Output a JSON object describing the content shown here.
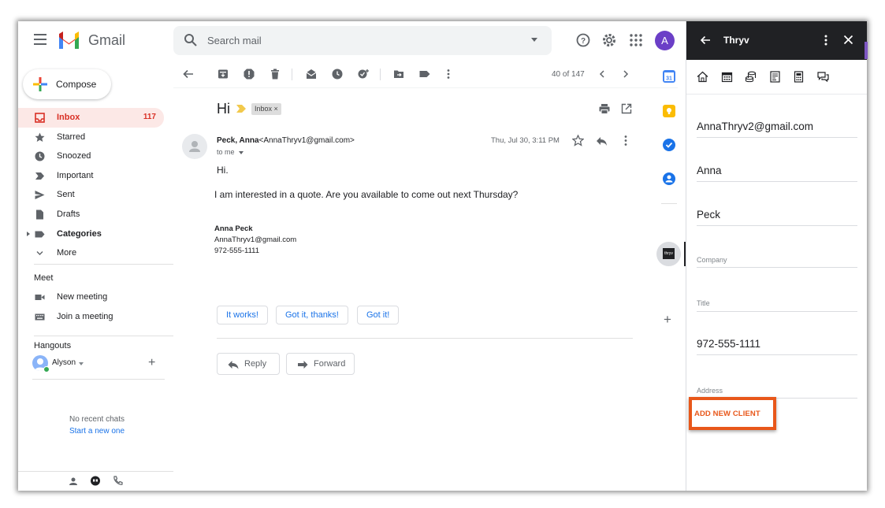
{
  "app": {
    "brand": "Gmail"
  },
  "search": {
    "placeholder": "Search mail"
  },
  "account": {
    "avatar_letter": "A",
    "avatar_color": "#6b3fc7"
  },
  "compose": {
    "label": "Compose"
  },
  "sidebar": {
    "items": [
      {
        "label": "Inbox",
        "count": "117",
        "icon": "inbox-icon"
      },
      {
        "label": "Starred",
        "icon": "star-icon"
      },
      {
        "label": "Snoozed",
        "icon": "clock-icon"
      },
      {
        "label": "Important",
        "icon": "important-icon"
      },
      {
        "label": "Sent",
        "icon": "send-icon"
      },
      {
        "label": "Drafts",
        "icon": "draft-icon"
      },
      {
        "label": "Categories",
        "icon": "label-icon"
      },
      {
        "label": "More",
        "icon": "chevron-down-icon"
      }
    ],
    "meet": {
      "heading": "Meet",
      "items": [
        {
          "label": "New meeting",
          "icon": "video-icon"
        },
        {
          "label": "Join a meeting",
          "icon": "keyboard-icon"
        }
      ]
    },
    "hangouts": {
      "heading": "Hangouts",
      "user": "Alyson",
      "no_chats": "No recent chats",
      "start_new": "Start a new one"
    }
  },
  "toolbar": {
    "pager": "40 of 147"
  },
  "email": {
    "subject": "Hi",
    "label": "Inbox ×",
    "sender_name": "Peck, Anna",
    "sender_email": "<AnnaThryv1@gmail.com>",
    "to": "to me",
    "date": "Thu, Jul 30, 3:11 PM",
    "greeting": "Hi.",
    "body": "I am interested in a quote. Are you available to come out next Thursday?",
    "signature": {
      "name": "Anna Peck",
      "email": "AnnaThryv1@gmail.com",
      "phone": "972-555-1111"
    },
    "smart_replies": [
      "It works!",
      "Got it, thanks!",
      "Got it!"
    ],
    "reply_label": "Reply",
    "forward_label": "Forward"
  },
  "thryv": {
    "title": "Thryv",
    "fields": {
      "email": "AnnaThryv2@gmail.com",
      "first_name": "Anna",
      "last_name": "Peck",
      "company_placeholder": "Company",
      "title_placeholder": "Title",
      "phone": "972-555-1111",
      "address_placeholder": "Address"
    },
    "add_client": "ADD NEW CLIENT",
    "accent": "#e8571a",
    "strip_logo": "thryv"
  },
  "colors": {
    "inbox_active_bg": "#fce8e6",
    "inbox_active_text": "#d93025",
    "link": "#1a73e8",
    "header_dark": "#202124"
  }
}
